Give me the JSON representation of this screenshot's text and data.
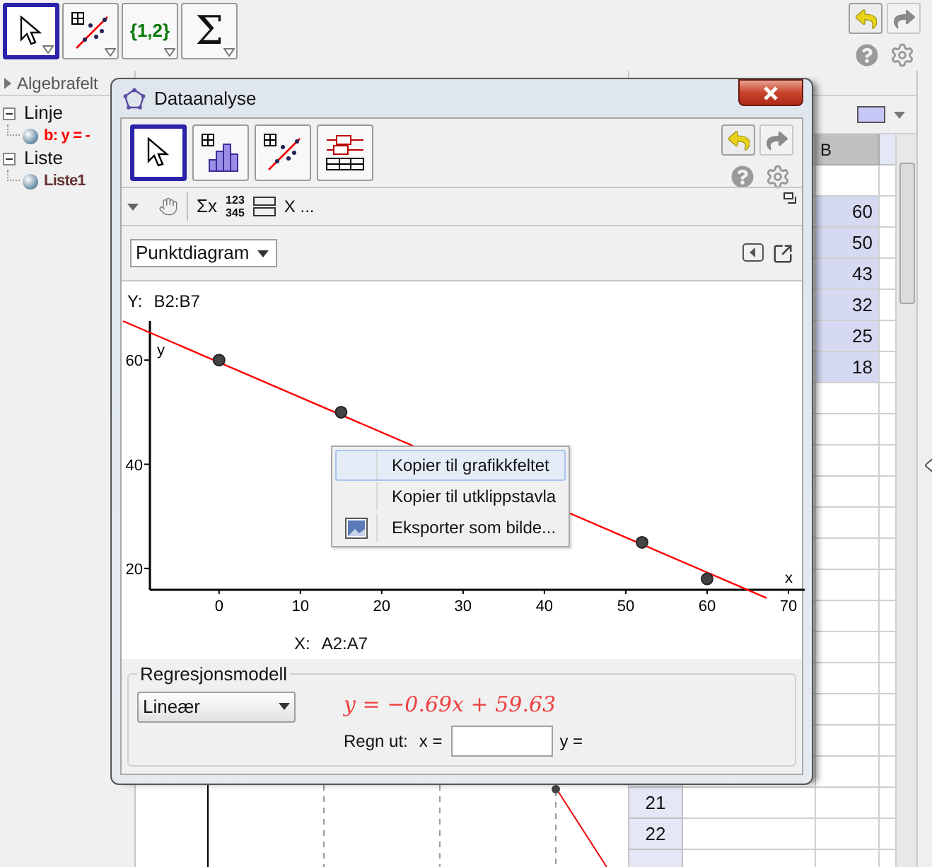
{
  "main_toolbar": {
    "tools": [
      {
        "kind": "move",
        "selected": true
      },
      {
        "kind": "scatter",
        "selected": false
      },
      {
        "kind": "list",
        "label": "{1,2}",
        "selected": false
      },
      {
        "kind": "sum",
        "label": "Σ",
        "selected": false
      }
    ]
  },
  "algebra_view": {
    "title": "Algebrafelt",
    "tree": [
      {
        "label": "Linje",
        "expanded": true,
        "children": [
          {
            "label": "b: y = -",
            "color": "#ff0000"
          }
        ]
      },
      {
        "label": "Liste",
        "expanded": true,
        "children": [
          {
            "label": "Liste1",
            "color": "#663333"
          }
        ]
      }
    ]
  },
  "spreadsheet": {
    "column_header": "B",
    "cells": [
      {
        "value": "60",
        "selected": true
      },
      {
        "value": "50",
        "selected": true
      },
      {
        "value": "43",
        "selected": true
      },
      {
        "value": "32",
        "selected": true
      },
      {
        "value": "25",
        "selected": true
      },
      {
        "value": "18",
        "selected": true
      }
    ],
    "row_numbers": [
      "21",
      "22"
    ]
  },
  "dialog": {
    "title": "Dataanalyse",
    "tools": [
      {
        "kind": "move",
        "selected": true
      },
      {
        "kind": "histogram",
        "selected": false
      },
      {
        "kind": "scatter",
        "selected": false
      },
      {
        "kind": "boxplot",
        "selected": false
      }
    ],
    "style_bar": {
      "sum_label": "Σx",
      "number_rows": [
        "123",
        "345"
      ],
      "variable_label": "X ..."
    },
    "plot_type": "Punktdiagram",
    "y_source": {
      "label": "Y:",
      "value": "B2:B7"
    },
    "x_source": {
      "label": "X:",
      "value": "A2:A7"
    },
    "chart_data": {
      "type": "scatter",
      "xlabel": "x",
      "ylabel": "y",
      "x": [
        0,
        15,
        52,
        60
      ],
      "series": [
        {
          "color": "#444444",
          "values": [
            60,
            50,
            25,
            18
          ]
        }
      ],
      "xlim": [
        -8.5,
        72
      ],
      "ylim": [
        15.9,
        67.5
      ],
      "xticks": [
        {
          "value": 0,
          "label": "0"
        },
        {
          "value": 10,
          "label": "10"
        },
        {
          "value": 20,
          "label": "20"
        },
        {
          "value": 30,
          "label": "30"
        },
        {
          "value": 40,
          "label": "40"
        },
        {
          "value": 50,
          "label": "50"
        },
        {
          "value": 60,
          "label": "60"
        },
        {
          "value": 70,
          "label": "70"
        }
      ],
      "yticks": [
        {
          "value": 20,
          "label": "20"
        },
        {
          "value": 40,
          "label": "40"
        },
        {
          "value": 60,
          "label": "60"
        }
      ]
    },
    "context_menu": [
      {
        "label": "Kopier til grafikkfeltet",
        "selected": true,
        "icon": false
      },
      {
        "label": "Kopier til utklippstavla",
        "selected": false,
        "icon": false
      },
      {
        "label": "Eksporter som bilde...",
        "selected": false,
        "icon": true
      }
    ],
    "regression": {
      "title": "Regresjonsmodell",
      "model": "Lineær",
      "equation": "y = −0.69x + 59.63",
      "compute_label": "Regn ut:",
      "x_label": "x =",
      "y_label": "y ="
    }
  }
}
